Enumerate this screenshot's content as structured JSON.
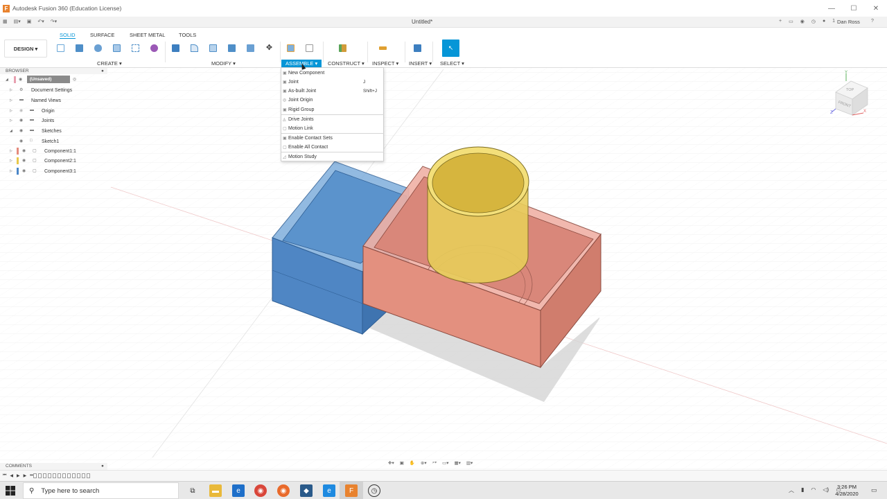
{
  "window": {
    "app_title": "Autodesk Fusion 360 (Education License)",
    "doc_title": "Untitled*",
    "user": "Dan Ross",
    "notif_count": "1"
  },
  "ribbon": {
    "workspace": "DESIGN",
    "tabs": [
      "SOLID",
      "SURFACE",
      "SHEET METAL",
      "TOOLS"
    ],
    "groups": [
      "CREATE",
      "MODIFY",
      "ASSEMBLE",
      "CONSTRUCT",
      "INSPECT",
      "INSERT",
      "SELECT"
    ]
  },
  "browser": {
    "title": "BROWSER",
    "root": "(Unsaved)",
    "items": [
      "Document Settings",
      "Named Views",
      "Origin",
      "Joints",
      "Sketches",
      "Sketch1",
      "Component1:1",
      "Component2:1",
      "Component3:1"
    ]
  },
  "assemble_menu": {
    "items": [
      {
        "label": "New Component",
        "shortcut": ""
      },
      {
        "label": "Joint",
        "shortcut": "J"
      },
      {
        "label": "As-built Joint",
        "shortcut": "Shift+J"
      },
      {
        "label": "Joint Origin",
        "shortcut": ""
      },
      {
        "label": "Rigid Group",
        "shortcut": ""
      },
      {
        "label": "Drive Joints",
        "shortcut": ""
      },
      {
        "label": "Motion Link",
        "shortcut": ""
      },
      {
        "label": "Enable Contact Sets",
        "shortcut": ""
      },
      {
        "label": "Enable All Contact",
        "shortcut": ""
      },
      {
        "label": "Motion Study",
        "shortcut": ""
      }
    ]
  },
  "viewcube": {
    "top": "TOP",
    "front": "FRONT",
    "axis_x": "X",
    "axis_y": "Y",
    "axis_z": "Z"
  },
  "comments": "COMMENTS",
  "colors": {
    "accent": "#0696d7",
    "component1": "#e58b7d",
    "component2": "#e8c84a",
    "component3": "#4a86c8"
  },
  "taskbar": {
    "search_placeholder": "Type here to search",
    "time": "3:26 PM",
    "date": "4/28/2020"
  }
}
